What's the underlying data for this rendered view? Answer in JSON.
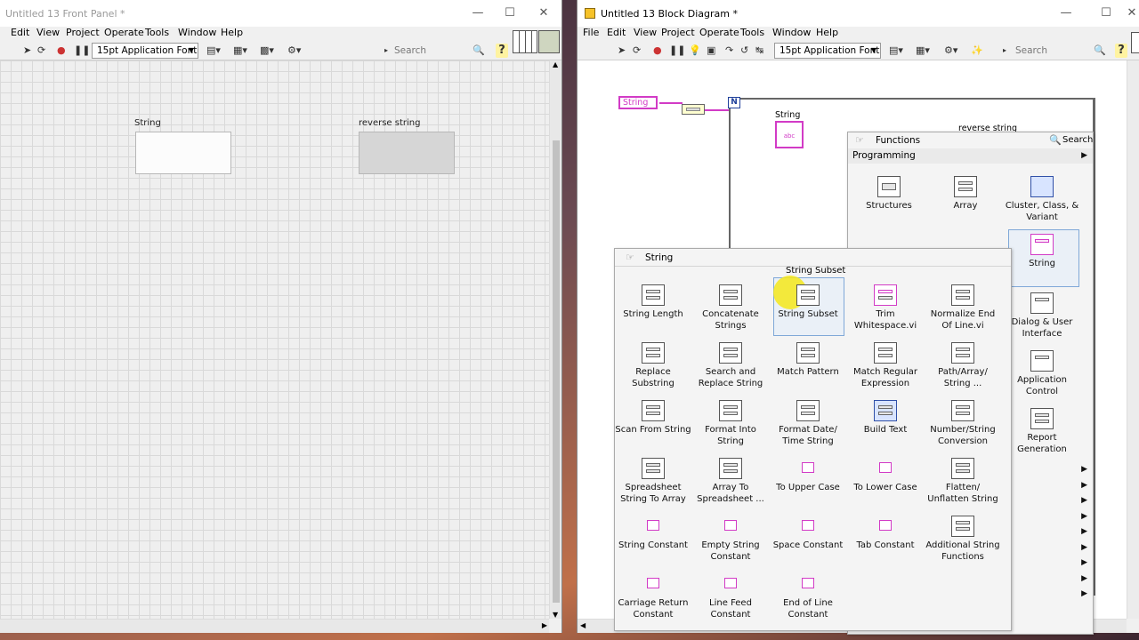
{
  "front_panel": {
    "title": "Untitled 13 Front Panel *",
    "menu": [
      "Edit",
      "View",
      "Project",
      "Operate",
      "Tools",
      "Window",
      "Help"
    ],
    "font": "15pt Application Font",
    "search_placeholder": "Search",
    "controls": [
      {
        "label": "String",
        "kind": "control"
      },
      {
        "label": "reverse string",
        "kind": "indicator"
      }
    ]
  },
  "block_diagram": {
    "title": "Untitled 13 Block Diagram *",
    "menu": [
      "File",
      "Edit",
      "View",
      "Project",
      "Operate",
      "Tools",
      "Window",
      "Help"
    ],
    "font": "15pt Application Font",
    "search_placeholder": "Search",
    "terminal_string": "String",
    "terminal_n": "N",
    "node_label": "String",
    "node_text": "abc",
    "indicator_label": "reverse string",
    "functions_palette": {
      "title": "Functions",
      "search_label": "Search",
      "category": "Programming",
      "items": [
        "Structures",
        "Array",
        "Cluster, Class, & Variant",
        "String",
        "Dialog & User Interface",
        "Application Control",
        "Report Generation"
      ]
    },
    "string_palette": {
      "title": "String",
      "tooltip": "String Subset",
      "items": [
        "String Length",
        "Concatenate Strings",
        "String Subset",
        "Trim Whitespace.vi",
        "Normalize End Of Line.vi",
        "Replace Substring",
        "Search and Replace String",
        "Match Pattern",
        "Match Regular Expression",
        "Path/Array/ String ...",
        "Scan From String",
        "Format Into String",
        "Format Date/ Time String",
        "Build Text",
        "Number/String Conversion",
        "Spreadsheet String To Array",
        "Array To Spreadsheet ...",
        "To Upper Case",
        "To Lower Case",
        "Flatten/ Unflatten String",
        "String Constant",
        "Empty String Constant",
        "Space Constant",
        "Tab Constant",
        "Additional String Functions",
        "Carriage Return Constant",
        "Line Feed Constant",
        "End of Line Constant"
      ]
    }
  },
  "colors": {
    "string_pink": "#d23bc6",
    "highlight": "#f4e81a",
    "selection": "#7fa8d8"
  }
}
